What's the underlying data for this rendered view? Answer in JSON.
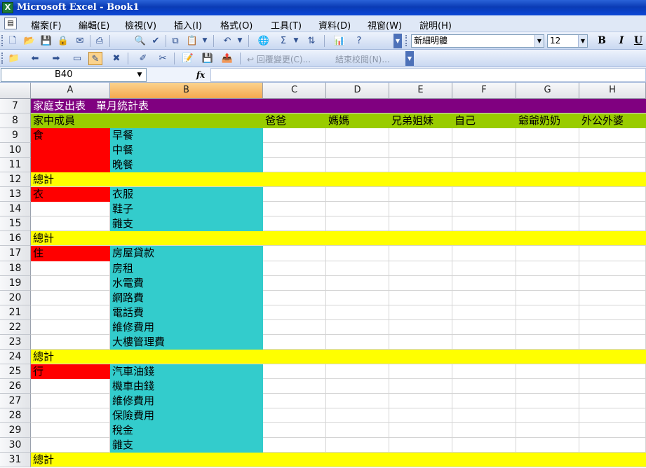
{
  "window": {
    "title": "Microsoft Excel - Book1",
    "app_icon": "excel-icon"
  },
  "menu": [
    "檔案(F)",
    "編輯(E)",
    "檢視(V)",
    "插入(I)",
    "格式(O)",
    "工具(T)",
    "資料(D)",
    "視窗(W)",
    "說明(H)"
  ],
  "toolbar": {
    "font_name": "新細明體",
    "font_size": "12",
    "bold_label": "B",
    "italic_label": "I",
    "underline_label": "U",
    "reply_changes_label": "回覆變更(C)...",
    "end_review_label": "結束校閱(N)..."
  },
  "formula_bar": {
    "name_box": "B40",
    "fx_label": "fx",
    "formula": ""
  },
  "sheet": {
    "columns": [
      "A",
      "B",
      "C",
      "D",
      "E",
      "F",
      "G",
      "H"
    ],
    "selected_column": "B",
    "colors": {
      "title_band": "#800080",
      "title_text": "#ffffff",
      "header_band": "#99cc00",
      "category": "#ff0000",
      "item": "#33cccc",
      "total": "#ffff00"
    },
    "rows": [
      {
        "num": "7",
        "type": "title",
        "text": "家庭支出表　單月統計表"
      },
      {
        "num": "8",
        "type": "header",
        "a": "家中成員",
        "members": [
          "爸爸",
          "媽媽",
          "兄弟姐妹",
          "自己",
          "爺爺奶奶",
          "外公外婆"
        ]
      },
      {
        "num": "9",
        "type": "data",
        "a": "食",
        "cat": true,
        "b": "早餐"
      },
      {
        "num": "10",
        "type": "data",
        "a": "",
        "cat": true,
        "b": "中餐"
      },
      {
        "num": "11",
        "type": "data",
        "a": "",
        "cat": true,
        "b": "晚餐"
      },
      {
        "num": "12",
        "type": "total",
        "text": "總計"
      },
      {
        "num": "13",
        "type": "data",
        "a": "衣",
        "cat": true,
        "b": "衣服"
      },
      {
        "num": "14",
        "type": "data",
        "a": "",
        "cat": false,
        "b": "鞋子"
      },
      {
        "num": "15",
        "type": "data",
        "a": "",
        "cat": false,
        "b": "雜支"
      },
      {
        "num": "16",
        "type": "total",
        "text": "總計"
      },
      {
        "num": "17",
        "type": "data",
        "a": "住",
        "cat": true,
        "b": "房屋貸款"
      },
      {
        "num": "18",
        "type": "data",
        "a": "",
        "cat": false,
        "b": "房租"
      },
      {
        "num": "19",
        "type": "data",
        "a": "",
        "cat": false,
        "b": "水電費"
      },
      {
        "num": "20",
        "type": "data",
        "a": "",
        "cat": false,
        "b": "網路費"
      },
      {
        "num": "21",
        "type": "data",
        "a": "",
        "cat": false,
        "b": "電話費"
      },
      {
        "num": "22",
        "type": "data",
        "a": "",
        "cat": false,
        "b": "維修費用"
      },
      {
        "num": "23",
        "type": "data",
        "a": "",
        "cat": false,
        "b": "大樓管理費"
      },
      {
        "num": "24",
        "type": "total",
        "text": "總計"
      },
      {
        "num": "25",
        "type": "data",
        "a": "行",
        "cat": true,
        "b": "汽車油錢"
      },
      {
        "num": "26",
        "type": "data",
        "a": "",
        "cat": false,
        "b": "機車由錢"
      },
      {
        "num": "27",
        "type": "data",
        "a": "",
        "cat": false,
        "b": "維修費用"
      },
      {
        "num": "28",
        "type": "data",
        "a": "",
        "cat": false,
        "b": "保險費用"
      },
      {
        "num": "29",
        "type": "data",
        "a": "",
        "cat": false,
        "b": "稅金"
      },
      {
        "num": "30",
        "type": "data",
        "a": "",
        "cat": false,
        "b": "雜支"
      },
      {
        "num": "31",
        "type": "total",
        "text": "總計"
      }
    ]
  }
}
